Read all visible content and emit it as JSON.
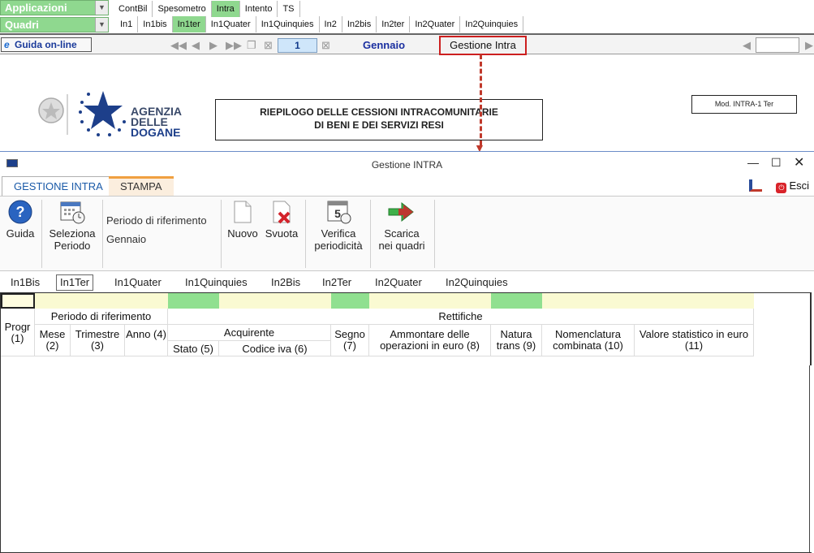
{
  "top": {
    "combo1": "Applicazioni",
    "combo2": "Quadri",
    "tabs1": [
      "ContBil",
      "Spesometro",
      "Intra",
      "Intento",
      "TS"
    ],
    "tabs2": [
      "In1",
      "In1bis",
      "In1ter",
      "In1Quater",
      "In1Quinquies",
      "In2",
      "In2bis",
      "In2ter",
      "In2Quater",
      "In2Quinquies"
    ]
  },
  "navbar": {
    "guida": "Guida on-line",
    "page": "1",
    "month": "Gennaio",
    "gestione": "Gestione Intra"
  },
  "document": {
    "agency": [
      "AGENZIA",
      "DELLE",
      "DOGANE"
    ],
    "title_line1": "RIEPILOGO DELLE CESSIONI INTRACOMUNITARIE",
    "title_line2": "DI BENI E DEI SERVIZI RESI",
    "mod": "Mod. INTRA-1 Ter"
  },
  "dialog": {
    "title": "Gestione INTRA",
    "tab_active": "GESTIONE INTRA",
    "tab_stampa": "STAMPA",
    "esci": "Esci",
    "ribbon": {
      "guida": "Guida",
      "seleziona1": "Seleziona",
      "seleziona2": "Periodo",
      "periodo_label": "Periodo di riferimento",
      "periodo_value": "Gennaio",
      "nuovo": "Nuovo",
      "svuota": "Svuota",
      "verifica1": "Verifica",
      "verifica2": "periodicità",
      "scarica1": "Scarica",
      "scarica2": "nei quadri"
    },
    "qtabs": [
      "In1Bis",
      "In1Ter",
      "In1Quater",
      "In1Quinquies",
      "In2Bis",
      "In2Ter",
      "In2Quater",
      "In2Quinquies"
    ],
    "headers": {
      "progr": "Progr (1)",
      "periodo": "Periodo di riferimento",
      "mese": "Mese (2)",
      "trimestre": "Trimestre (3)",
      "anno": "Anno (4)",
      "rettifiche": "Rettifiche",
      "acquirente": "Acquirente",
      "stato": "Stato (5)",
      "codice_iva": "Codice iva (6)",
      "segno": "Segno (7)",
      "ammontare": "Ammontare delle operazioni in euro (8)",
      "natura": "Natura trans (9)",
      "nomenclatura": "Nomenclatura combinata (10)",
      "valore": "Valore statistico in euro (11)"
    }
  }
}
